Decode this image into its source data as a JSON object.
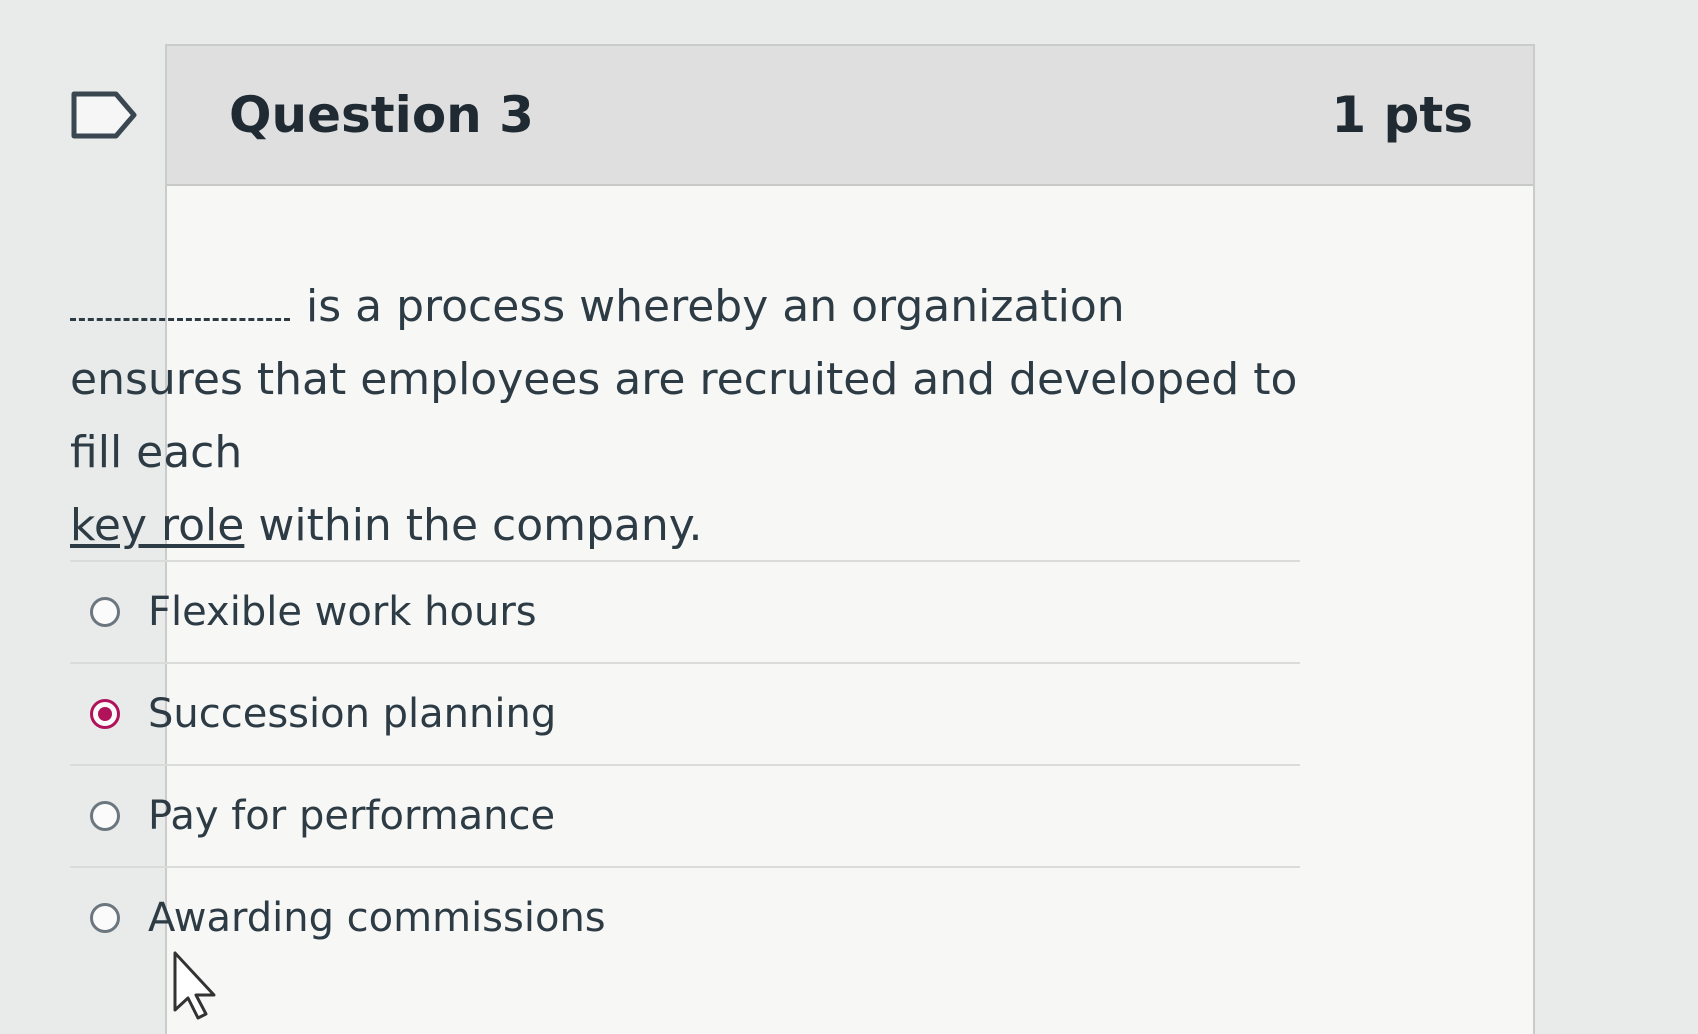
{
  "question": {
    "title": "Question 3",
    "points": "1 pts",
    "text": {
      "blank": "",
      "line_part1": "is a process whereby an organization ensures that employees are recruited and developed to fill each",
      "key_term": "key role",
      "line_part2": "within the company."
    }
  },
  "answers": [
    {
      "label": "Flexible work hours",
      "selected": false
    },
    {
      "label": "Succession planning",
      "selected": true
    },
    {
      "label": "Pay for performance",
      "selected": false
    },
    {
      "label": "Awarding commissions",
      "selected": false
    }
  ],
  "colors": {
    "accent_selected": "#b0135a",
    "header_bg": "#dedfde",
    "text": "#2d3b45"
  },
  "icons": {
    "flag": "flag-bookmark-icon",
    "cursor": "mouse-pointer-icon"
  }
}
